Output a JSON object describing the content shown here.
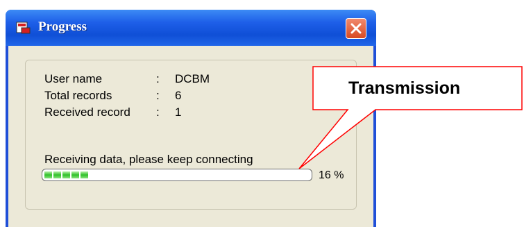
{
  "window": {
    "title": "Progress",
    "icon": "app-icon",
    "close_icon": "close-icon"
  },
  "info": {
    "user_name_label": "User name",
    "user_name_value": "DCBM",
    "total_records_label": "Total records",
    "total_records_value": "6",
    "received_record_label": "Received record",
    "received_record_value": "1",
    "separator": ":"
  },
  "status": {
    "text": "Receiving data, please keep connecting",
    "progress_fraction": 0.16,
    "percent_text": "16 %"
  },
  "callout": {
    "text": "Transmission"
  },
  "colors": {
    "titlebar": "#1e5fe8",
    "close_button": "#d94a22",
    "progress_green": "#2fc12a",
    "callout_border": "#ff0000"
  }
}
